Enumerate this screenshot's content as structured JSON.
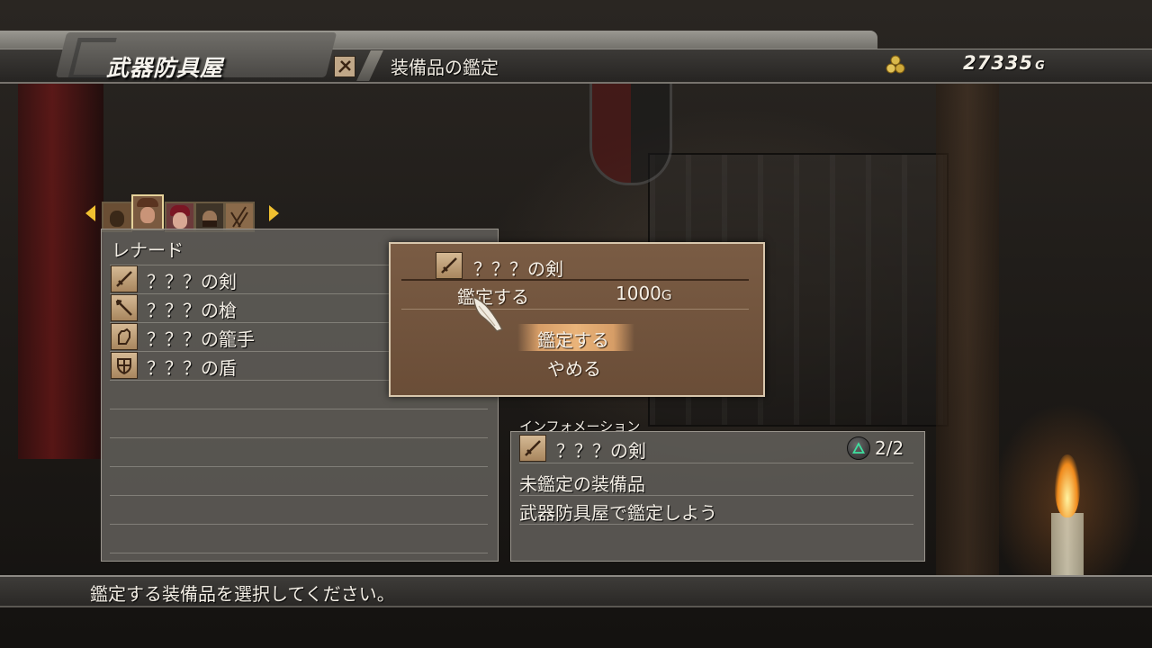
{
  "header": {
    "shop_title": "武器防具屋",
    "mode_title": "装備品の鑑定",
    "gold_amount": "27335",
    "gold_unit": "G"
  },
  "party": {
    "portraits": [
      {
        "name": "portrait-1",
        "selected": false
      },
      {
        "name": "portrait-2",
        "selected": true
      },
      {
        "name": "portrait-3",
        "selected": false
      },
      {
        "name": "portrait-4",
        "selected": false
      },
      {
        "name": "portrait-5",
        "selected": false
      }
    ]
  },
  "inventory": {
    "character_name": "レナード",
    "items": [
      {
        "label": "？？？の剣",
        "icon": "sword-icon"
      },
      {
        "label": "？？？の槍",
        "icon": "spear-icon"
      },
      {
        "label": "？？？の籠手",
        "icon": "gauntlet-icon"
      },
      {
        "label": "？？？の盾",
        "icon": "shield-icon"
      }
    ]
  },
  "dialog": {
    "item_name": "？？？の剣",
    "action_label": "鑑定する",
    "price": "1000",
    "price_unit": "G",
    "options": [
      "鑑定する",
      "やめる"
    ],
    "selected_option": 0
  },
  "information": {
    "header_label": "インフォメーション",
    "item_name": "？？？の剣",
    "page": "2/2",
    "lines": [
      "未鑑定の装備品",
      "武器防具屋で鑑定しよう"
    ]
  },
  "footer": {
    "help_text": "鑑定する装備品を選択してください。"
  },
  "colors": {
    "dialog_bg": "#70533c",
    "selection": "#f0b97d",
    "arrow": "#f0c030"
  }
}
